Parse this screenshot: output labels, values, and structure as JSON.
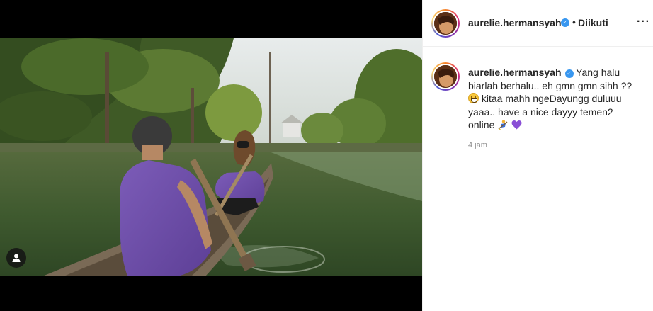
{
  "post": {
    "username": "aurelie.hermansyah",
    "follow_status": "Diikuti",
    "bullet": "•",
    "more_icon": "more-options-icon",
    "verified_icon": "verified-badge-icon",
    "caption_lines": [
      "Yang halu",
      "biarlah berhalu.. eh gmn gmn sihh ??",
      "kitaa mahh ngeDayungg duluuu",
      "yaaa.. have a nice dayyy temen2",
      "online"
    ],
    "caption_emojis": [
      "grinning-face-emoji",
      "person-rowing-emoji",
      "purple-heart-emoji"
    ],
    "timestamp": "4 jam"
  },
  "media": {
    "description_icon": "tagged-user-icon",
    "scene": "two people rowing a wooden canoe on a green pond surrounded by trees"
  },
  "colors": {
    "verified": "#3897f0",
    "muted_text": "#8e8e8e",
    "border": "#efefef",
    "heart": "#8a4fd6"
  }
}
